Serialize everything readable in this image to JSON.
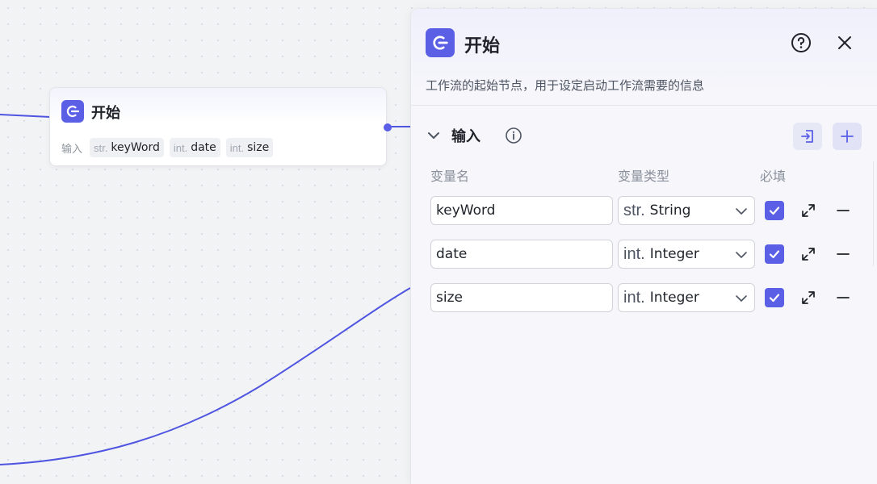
{
  "node": {
    "title": "开始",
    "inputs_label": "输入",
    "chips": [
      {
        "type": "str.",
        "name": "keyWord"
      },
      {
        "type": "int.",
        "name": "date"
      },
      {
        "type": "int.",
        "name": "size"
      }
    ]
  },
  "panel": {
    "title": "开始",
    "description": "工作流的起始节点，用于设定启动工作流需要的信息",
    "section_title": "输入",
    "columns": {
      "name": "变量名",
      "type": "变量类型",
      "required": "必填"
    },
    "rows": [
      {
        "name": "keyWord",
        "type_prefix": "str.",
        "type_label": "String",
        "required": true
      },
      {
        "name": "date",
        "type_prefix": "int.",
        "type_label": "Integer",
        "required": true
      },
      {
        "name": "size",
        "type_prefix": "int.",
        "type_label": "Integer",
        "required": true
      }
    ]
  },
  "colors": {
    "accent": "#5a5fe6",
    "edge": "#4f55e0",
    "canvas": "#f2f3f5"
  },
  "icons": {
    "node_icon": "start-node-icon",
    "help": "question-circle-icon",
    "close": "close-icon",
    "collapse": "chevron-down-icon",
    "info": "info-circle-icon",
    "import": "import-icon",
    "add": "plus-icon",
    "expand": "expand-arrows-icon",
    "remove": "minus-icon"
  }
}
